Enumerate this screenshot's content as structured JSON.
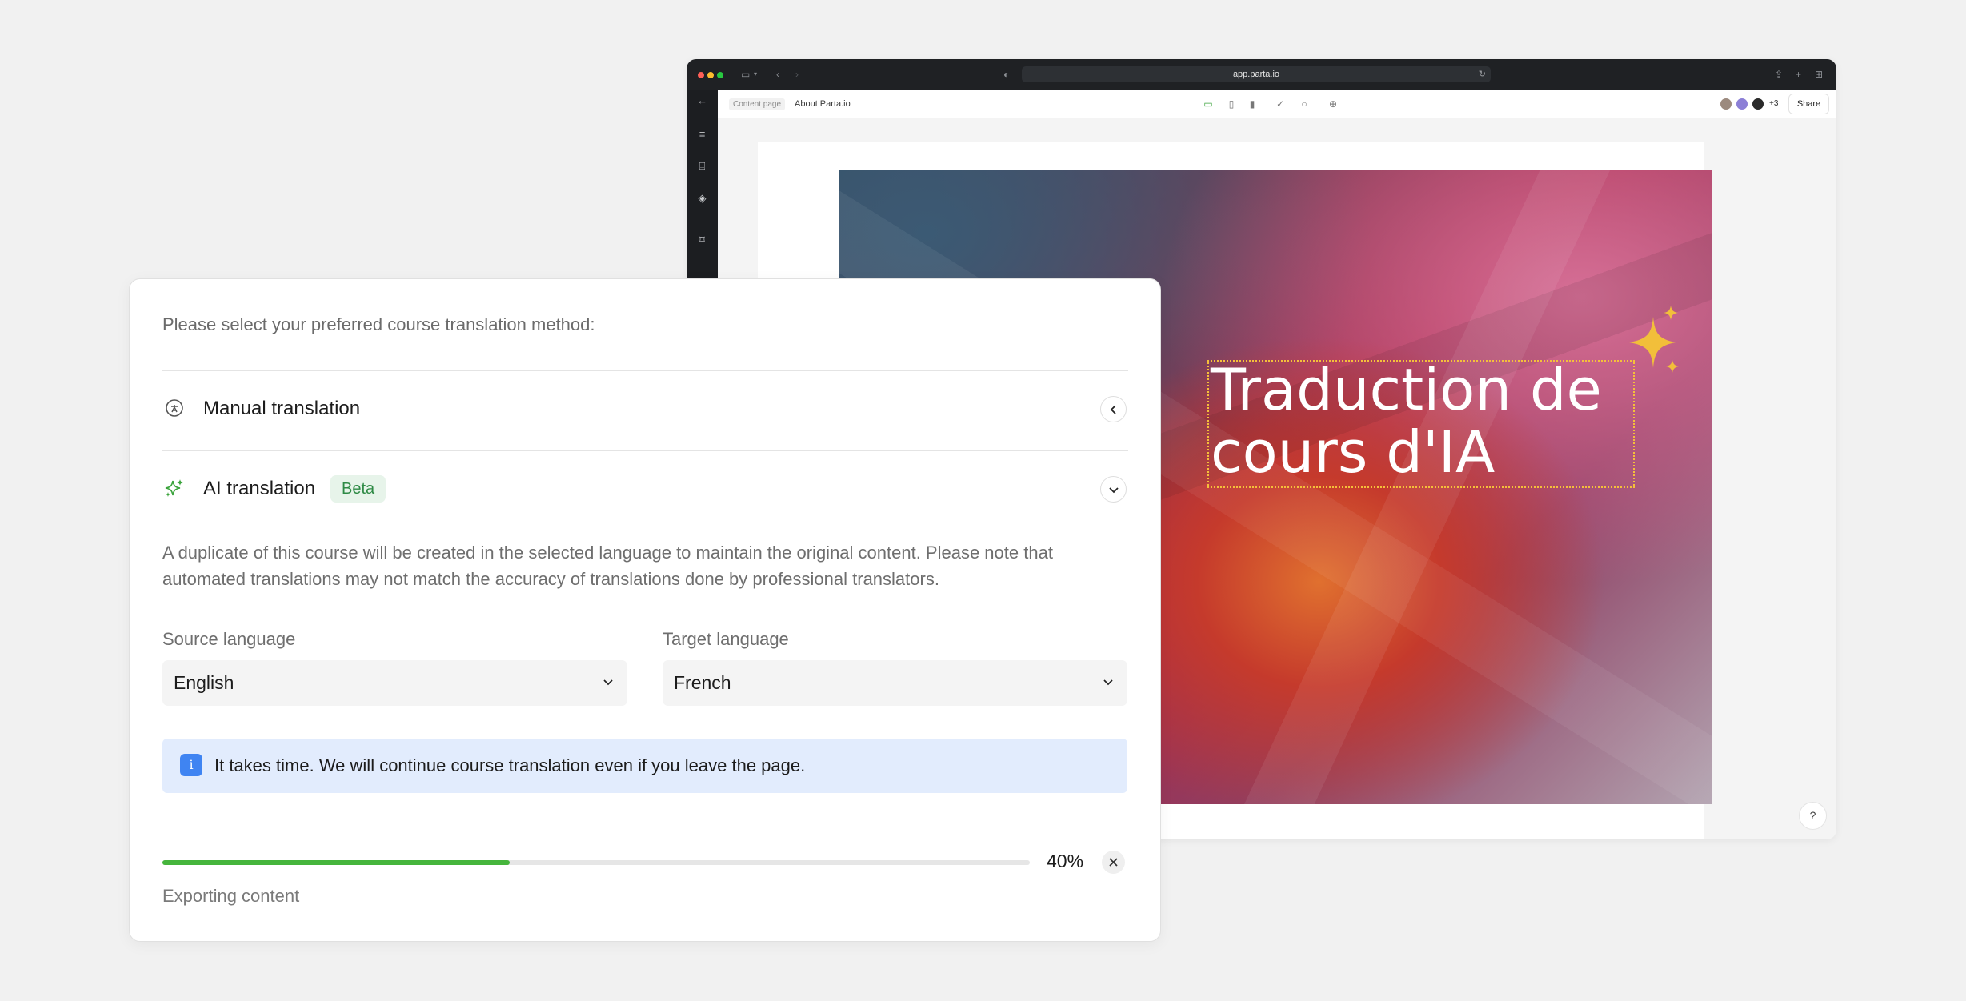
{
  "browser": {
    "url": "app.parta.io",
    "breadcrumb_tag": "Content page",
    "breadcrumb_title": "About Parta.io",
    "more_avatars": "+3",
    "share_label": "Share",
    "help_label": "?"
  },
  "hero": {
    "title": "Traduction de cours d'IA"
  },
  "panel": {
    "prompt": "Please select your preferred course translation method:",
    "manual_label": "Manual translation",
    "ai_label": "AI translation",
    "beta_label": "Beta",
    "description": "A duplicate of this course will be created in the selected language to maintain the original content. Please note that automated translations may not match the accuracy of translations done by professional translators.",
    "source_label": "Source language",
    "source_value": "English",
    "target_label": "Target language",
    "target_value": "French",
    "info_text": "It takes time. We will continue course translation even if you leave the page.",
    "progress_percent": 40,
    "progress_label": "40%",
    "status_text": "Exporting content"
  },
  "colors": {
    "accent_green": "#46b53c",
    "info_bg": "#e2ecfd",
    "info_icon": "#3f84f2",
    "beta_bg": "#e7f4ea",
    "beta_text": "#2e8a45",
    "sparkle": "#f2bf3a"
  }
}
